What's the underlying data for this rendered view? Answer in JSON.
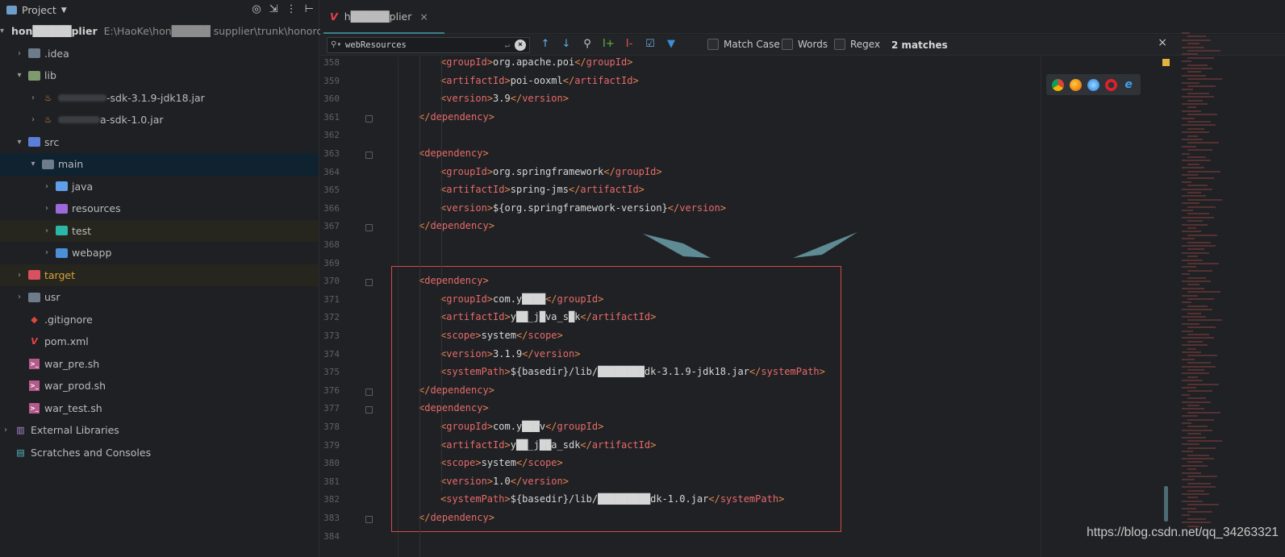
{
  "project_panel": {
    "title": "Project",
    "caret": "▼",
    "header_icons": [
      "target-icon",
      "collapse-icon",
      "more-icon",
      "hide-icon"
    ],
    "root": {
      "name": "hon█████plier",
      "path": "E:\\HaoKe\\hon█████ supplier\\trunk\\honorc"
    },
    "items": [
      {
        "label": ".idea"
      },
      {
        "label": "lib"
      },
      {
        "label": "-sdk-3.1.9-jdk18.jar"
      },
      {
        "label": "a-sdk-1.0.jar"
      },
      {
        "label": "src"
      },
      {
        "label": "main"
      },
      {
        "label": "java"
      },
      {
        "label": "resources"
      },
      {
        "label": "test"
      },
      {
        "label": "webapp"
      },
      {
        "label": "target"
      },
      {
        "label": "usr"
      },
      {
        "label": ".gitignore"
      },
      {
        "label": "pom.xml"
      },
      {
        "label": "war_pre.sh"
      },
      {
        "label": "war_prod.sh"
      },
      {
        "label": "war_test.sh"
      },
      {
        "label": "External Libraries"
      },
      {
        "label": "Scratches and Consoles"
      }
    ]
  },
  "editor": {
    "tab_label": "h█████plier",
    "tab_close": "×",
    "find": {
      "query": "webResources",
      "options": [
        {
          "label": "Match Case"
        },
        {
          "label": "Words"
        },
        {
          "label": "Regex"
        }
      ],
      "matches": "2 matches",
      "close": "×"
    },
    "lines": [
      {
        "n": "358",
        "open": "groupId",
        "text": "org.apache.poi",
        "close": "groupId",
        "indent": 2
      },
      {
        "n": "359",
        "open": "artifactId",
        "text": "poi-ooxml",
        "close": "artifactId",
        "indent": 2
      },
      {
        "n": "360",
        "open": "version",
        "text": "3.9",
        "close": "version",
        "indent": 2
      },
      {
        "n": "361",
        "closeonly": "dependency",
        "indent": 1
      },
      {
        "n": "362",
        "blank": true
      },
      {
        "n": "363",
        "openonly": "dependency",
        "indent": 1
      },
      {
        "n": "364",
        "open": "groupId",
        "text": "org.springframework",
        "close": "groupId",
        "indent": 2
      },
      {
        "n": "365",
        "open": "artifactId",
        "text": "spring-jms",
        "close": "artifactId",
        "indent": 2
      },
      {
        "n": "366",
        "open": "version",
        "text": "${org.springframework-version}",
        "close": "version",
        "indent": 2
      },
      {
        "n": "367",
        "closeonly": "dependency",
        "indent": 1
      },
      {
        "n": "368",
        "blank": true
      },
      {
        "n": "369",
        "blank": true
      },
      {
        "n": "370",
        "openonly": "dependency",
        "indent": 1
      },
      {
        "n": "371",
        "open": "groupId",
        "text": "com.y████",
        "close": "groupId",
        "indent": 2
      },
      {
        "n": "372",
        "open": "artifactId",
        "text": "y██_j█va_s█k",
        "close": "artifactId",
        "indent": 2
      },
      {
        "n": "373",
        "open": "scope",
        "text": "system",
        "close": "scope",
        "indent": 2
      },
      {
        "n": "374",
        "open": "version",
        "text": "3.1.9",
        "close": "version",
        "indent": 2
      },
      {
        "n": "375",
        "open": "systemPath",
        "text": "${basedir}/lib/████████dk-3.1.9-jdk18.jar",
        "close": "systemPath",
        "indent": 2
      },
      {
        "n": "376",
        "closeonly": "dependency",
        "indent": 1
      },
      {
        "n": "377",
        "openonly": "dependency",
        "indent": 1
      },
      {
        "n": "378",
        "open": "groupId",
        "text": "com.y███v",
        "close": "groupId",
        "indent": 2
      },
      {
        "n": "379",
        "open": "artifactId",
        "text": "y██_j██a_sdk",
        "close": "artifactId",
        "indent": 2
      },
      {
        "n": "380",
        "open": "scope",
        "text": "system",
        "close": "scope",
        "indent": 2
      },
      {
        "n": "381",
        "open": "version",
        "text": "1.0",
        "close": "version",
        "indent": 2
      },
      {
        "n": "382",
        "open": "systemPath",
        "text": "${basedir}/lib/█████████dk-1.0.jar",
        "close": "systemPath",
        "indent": 2
      },
      {
        "n": "383",
        "closeonly": "dependency",
        "indent": 1
      },
      {
        "n": "384",
        "blank": true
      }
    ]
  },
  "watermark": "https://blog.csdn.net/qq_34263321",
  "colors": {
    "tag": "#e8874d",
    "tagname": "#e86a6a",
    "accent": "#3d7f8a",
    "highlight_box": "#d8484b"
  }
}
